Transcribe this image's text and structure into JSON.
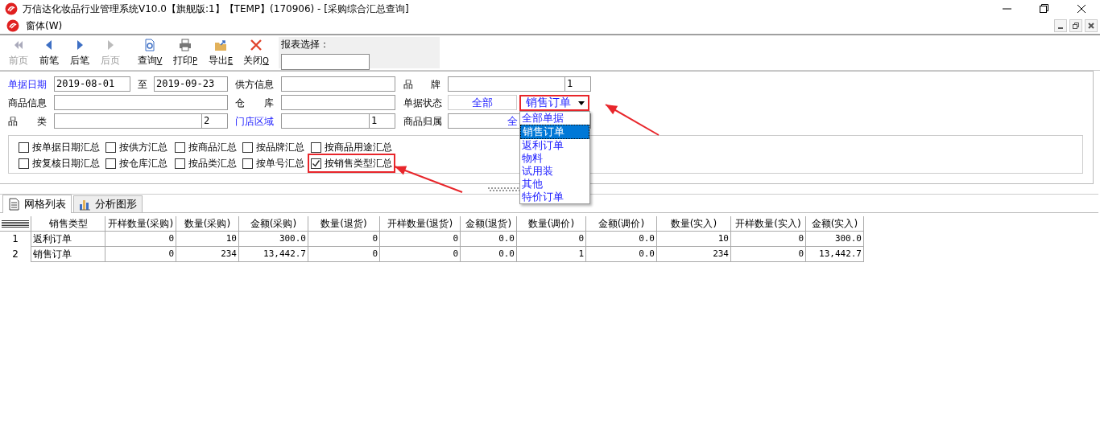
{
  "window": {
    "title": "万信达化妆品行业管理系统V10.0【旗舰版:1】【TEMP】(170906) - [采购综合汇总查询]"
  },
  "menu": {
    "items": [
      "窗体(W)"
    ]
  },
  "toolbar": {
    "buttons": [
      {
        "label": "前页",
        "kind": "first",
        "disabled": true
      },
      {
        "label": "前笔",
        "kind": "prev",
        "disabled": false
      },
      {
        "label": "后笔",
        "kind": "next",
        "disabled": false
      },
      {
        "label": "后页",
        "kind": "last",
        "disabled": true
      },
      {
        "label": "查询",
        "hotkey": "V",
        "kind": "query",
        "disabled": false
      },
      {
        "label": "打印",
        "hotkey": "P",
        "kind": "print",
        "disabled": false
      },
      {
        "label": "导出",
        "hotkey": "E",
        "kind": "export",
        "disabled": false
      },
      {
        "label": "关闭",
        "hotkey": "Q",
        "kind": "close",
        "disabled": false
      }
    ],
    "report_select": {
      "label": "报表选择："
    }
  },
  "filters": [
    [
      {
        "label": "单据日期",
        "link": true,
        "kind": "date_range",
        "from": "2019-08-01",
        "sep": "至",
        "to": "2019-09-23"
      },
      {
        "label": "供方信息",
        "link": false,
        "kind": "text"
      },
      {
        "label": "品 牌",
        "link": false,
        "kind": "coded",
        "code": "1"
      }
    ],
    [
      {
        "label": "商品信息",
        "link": false,
        "kind": "text"
      },
      {
        "label": "仓 库",
        "link": false,
        "kind": "text"
      },
      {
        "label": "单据状态",
        "link": false,
        "kind": "status",
        "all": "全部",
        "value": "销售订单",
        "highlighted": true,
        "expanded": true,
        "options": [
          {
            "label": "全部单据",
            "selected": false
          },
          {
            "label": "销售订单",
            "selected": true
          },
          {
            "label": "返利订单",
            "selected": false
          },
          {
            "label": "物料",
            "selected": false
          },
          {
            "label": "试用装",
            "selected": false
          },
          {
            "label": "其他",
            "selected": false
          },
          {
            "label": "特价订单",
            "selected": false
          }
        ]
      }
    ],
    [
      {
        "label": "品 类",
        "link": false,
        "kind": "coded",
        "code": "2"
      },
      {
        "label": "门店区域",
        "link": true,
        "kind": "coded",
        "code": "1"
      },
      {
        "label": "商品归属",
        "link": false,
        "kind": "partial",
        "value": "全"
      }
    ]
  ],
  "summary_options": [
    {
      "label": "按单据日期汇总",
      "checked": false,
      "highlighted": false
    },
    {
      "label": "按供方汇总",
      "checked": false,
      "highlighted": false
    },
    {
      "label": "按商品汇总",
      "checked": false,
      "highlighted": false
    },
    {
      "label": "按品牌汇总",
      "checked": false,
      "highlighted": false
    },
    {
      "label": "按商品用途汇总",
      "checked": false,
      "highlighted": false
    },
    {
      "label": "按复核日期汇总",
      "checked": false,
      "highlighted": false
    },
    {
      "label": "按仓库汇总",
      "checked": false,
      "highlighted": false
    },
    {
      "label": "按品类汇总",
      "checked": false,
      "highlighted": false
    },
    {
      "label": "按单号汇总",
      "checked": false,
      "highlighted": false
    },
    {
      "label": "按销售类型汇总",
      "checked": true,
      "highlighted": true
    }
  ],
  "tabs": [
    {
      "label": "网格列表",
      "kind": "grid",
      "selected": true
    },
    {
      "label": "分析图形",
      "kind": "chart",
      "selected": false
    }
  ],
  "table": {
    "columns": [
      "销售类型",
      "开样数量(采购)",
      "数量(采购)",
      "金额(采购)",
      "数量(退货)",
      "开样数量(退货)",
      "金额(退货)",
      "数量(调价)",
      "金额(调价)",
      "数量(实入)",
      "开样数量(实入)",
      "金额(实入)"
    ],
    "rows": [
      {
        "index": "1",
        "cells": [
          "返利订单",
          "0",
          "10",
          "300.0",
          "0",
          "0",
          "0.0",
          "0",
          "0.0",
          "10",
          "0",
          "300.0"
        ]
      },
      {
        "index": "2",
        "cells": [
          "销售订单",
          "0",
          "234",
          "13,442.7",
          "0",
          "0",
          "0.0",
          "1",
          "0.0",
          "234",
          "0",
          "13,442.7"
        ]
      }
    ]
  }
}
